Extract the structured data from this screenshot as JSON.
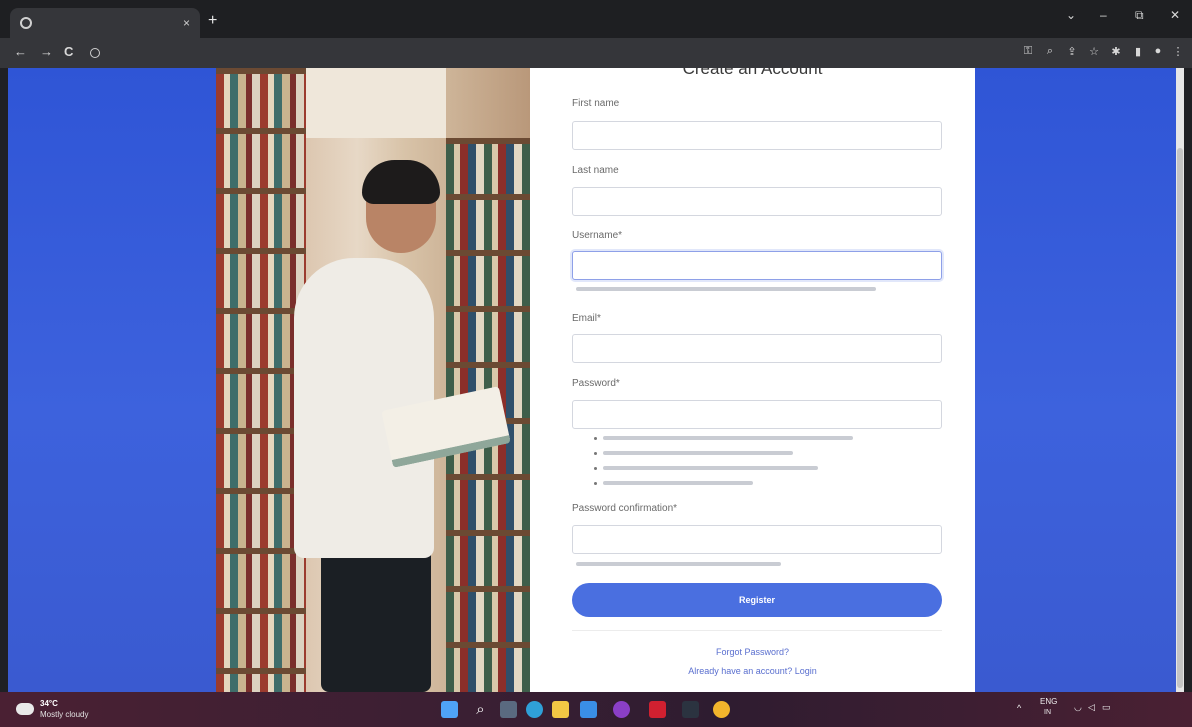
{
  "browser": {
    "tab_title": "",
    "tab_close": "×",
    "new_tab": "+",
    "url": "",
    "window_controls": {
      "minimize": "–",
      "restore": "⧉",
      "close": "✕",
      "tabsearch": "⌄"
    },
    "nav": {
      "back": "←",
      "forward": "→",
      "reload": "C"
    }
  },
  "form": {
    "title": "Create an Account",
    "fields": {
      "first_name": {
        "label": "First name",
        "value": ""
      },
      "last_name": {
        "label": "Last name",
        "value": ""
      },
      "username": {
        "label": "Username*",
        "value": "",
        "help": ""
      },
      "email": {
        "label": "Email*",
        "value": ""
      },
      "password": {
        "label": "Password*",
        "value": ""
      },
      "password_confirmation": {
        "label": "Password confirmation*",
        "value": "",
        "help": ""
      }
    },
    "password_hints": [],
    "register_label": "Register",
    "forgot_password": "Forgot Password?",
    "login_prompt": "Already have an account? Login"
  },
  "taskbar": {
    "weather_temp": "34°C",
    "weather_desc": "Mostly cloudy",
    "language": "ENG",
    "region": "IN",
    "time": "",
    "date": "",
    "apps": [
      "start-icon",
      "search-icon",
      "taskview-icon",
      "edge-icon",
      "file-explorer-icon",
      "mail-icon",
      "app-icon",
      "app-icon",
      "app-icon",
      "chrome-icon"
    ],
    "colors": {
      "start": "#4fa3f7",
      "edge": "#2fa0d8",
      "explorer": "#f2c744",
      "mail": "#3a8ee6",
      "chrome": "#f2b52c"
    }
  },
  "colors": {
    "accent": "#4a6fe0",
    "page_bg": "#3358d8"
  }
}
